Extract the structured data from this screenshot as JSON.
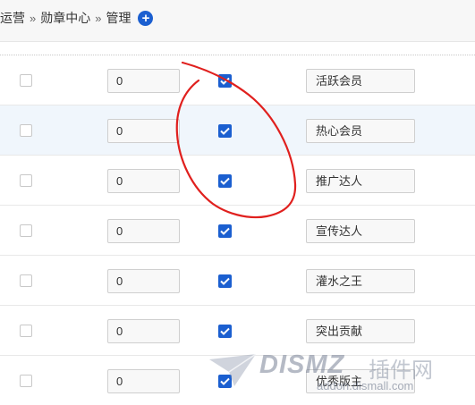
{
  "breadcrumb": {
    "items": [
      "运营",
      "勋章中心",
      "管理"
    ],
    "separator": "»"
  },
  "add_button": {
    "icon": "plus-circle-icon",
    "glyph": "+",
    "color": "#1b5fd0"
  },
  "medals": [
    {
      "order": "0",
      "enabled": true,
      "name": "活跃会员"
    },
    {
      "order": "0",
      "enabled": true,
      "name": "热心会员"
    },
    {
      "order": "0",
      "enabled": true,
      "name": "推广达人"
    },
    {
      "order": "0",
      "enabled": true,
      "name": "宣传达人"
    },
    {
      "order": "0",
      "enabled": true,
      "name": "灌水之王"
    },
    {
      "order": "0",
      "enabled": true,
      "name": "突出贡献"
    },
    {
      "order": "0",
      "enabled": true,
      "name": "优秀版主"
    }
  ],
  "colors": {
    "accent": "#1b5fd0",
    "row_highlight": "#f0f6fc",
    "annotation_stroke": "#e0201e"
  },
  "watermark": {
    "logo_text": "DISMZ",
    "site_name": "插件网",
    "url": "addon.dismall.com"
  }
}
